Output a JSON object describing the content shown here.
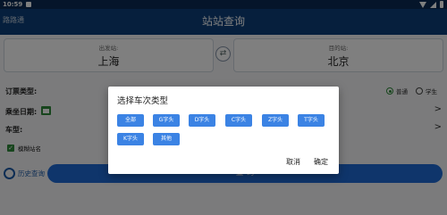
{
  "status_bar": {
    "time": "10:59"
  },
  "app_bar": {
    "brand": "路路通",
    "title": "站站查询"
  },
  "stations": {
    "from_label": "出发站:",
    "from_value": "上海",
    "to_label": "目的站:",
    "to_value": "北京",
    "swap_icon": "swap-icon"
  },
  "form": {
    "ticket_type_label": "订票类型:",
    "ticket_options": [
      {
        "label": "普通",
        "checked": true
      },
      {
        "label": "学生",
        "checked": false
      }
    ],
    "date_label": "乘坐日期:",
    "car_type_label": "车型:",
    "fuzzy_label": "模糊站名",
    "fuzzy_checked": true
  },
  "footer": {
    "history_label": "历史查询",
    "query_label": "查 询"
  },
  "dialog": {
    "title": "选择车次类型",
    "chips": [
      "全部",
      "G字头",
      "D字头",
      "C字头",
      "Z字头",
      "T字头",
      "K字头",
      "其他"
    ],
    "cancel": "取消",
    "confirm": "确定"
  },
  "colors": {
    "app_bar": "#0d3f7a",
    "accent": "#1e6bd6",
    "chip": "#3b83e4",
    "checked": "#2f8a3a"
  }
}
